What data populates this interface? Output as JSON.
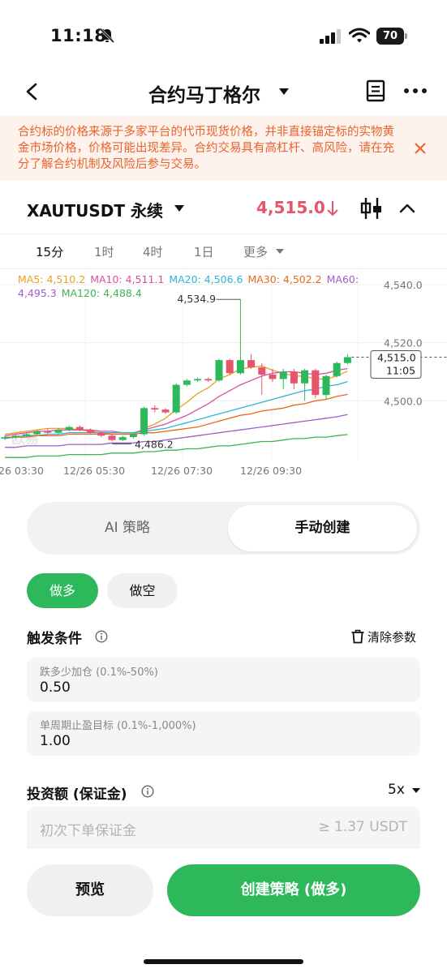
{
  "status_bar": {
    "time": "11:18",
    "battery": "70"
  },
  "header": {
    "title": "合约马丁格尔"
  },
  "notice": {
    "text": "合约标的价格来源于多家平台的代币现货价格，并非直接锚定标的实物黄金市场价格，价格可能出现差异。合约交易具有高杠杆、高风险，请在充分了解合约机制及风险后参与交易。"
  },
  "symbol": {
    "name": "XAUTUSDT 永续",
    "price": "4,515.0",
    "price_color": "#e5566d"
  },
  "timeframes": {
    "items": [
      "15分",
      "1时",
      "4时",
      "1日"
    ],
    "more": "更多",
    "active": "15分"
  },
  "chart": {
    "ma_legend": [
      {
        "label": "MA5: 4,510.2",
        "color": "#e8a21e"
      },
      {
        "label": "MA10: 4,511.1",
        "color": "#d94fa0"
      },
      {
        "label": "MA20: 4,506.6",
        "color": "#2bb5d6"
      },
      {
        "label": "MA30: 4,502.2",
        "color": "#e8691e"
      },
      {
        "label": "MA60:",
        "color": "#a05cc9"
      },
      {
        "label": "4,495.3",
        "color": "#a05cc9"
      },
      {
        "label": "MA120: 4,488.4",
        "color": "#3eb356"
      }
    ],
    "price_ticks": [
      "4,540.0",
      "4,520.0",
      "4,500.0"
    ],
    "current_price_tag": "4,515.0",
    "countdown": "11:05",
    "high_label": "4,534.9",
    "low_label": "4,486.2",
    "time_ticks": [
      "26 03:30",
      "12/26 05:30",
      "12/26 07:30",
      "12/26 09:30"
    ],
    "watermark": "欧易"
  },
  "chart_data": {
    "type": "candlestick",
    "up_color": "#2eb85c",
    "down_color": "#e5566d",
    "ylim": [
      4480,
      4545
    ],
    "yticks": [
      4540.0,
      4520.0,
      4500.0
    ],
    "candles": [
      {
        "o": 4487.0,
        "h": 4488.0,
        "l": 4486.5,
        "c": 4487.5
      },
      {
        "o": 4487.5,
        "h": 4488.5,
        "l": 4487.0,
        "c": 4488.0
      },
      {
        "o": 4488.0,
        "h": 4489.0,
        "l": 4487.5,
        "c": 4488.5
      },
      {
        "o": 4488.5,
        "h": 4490.0,
        "l": 4488.0,
        "c": 4489.5
      },
      {
        "o": 4489.5,
        "h": 4490.5,
        "l": 4488.5,
        "c": 4489.0
      },
      {
        "o": 4489.0,
        "h": 4490.5,
        "l": 4488.5,
        "c": 4490.0
      },
      {
        "o": 4490.0,
        "h": 4491.5,
        "l": 4489.5,
        "c": 4491.0
      },
      {
        "o": 4491.0,
        "h": 4491.5,
        "l": 4489.5,
        "c": 4490.0
      },
      {
        "o": 4490.0,
        "h": 4490.5,
        "l": 4488.5,
        "c": 4489.0
      },
      {
        "o": 4489.0,
        "h": 4489.5,
        "l": 4487.5,
        "c": 4488.0
      },
      {
        "o": 4488.0,
        "h": 4488.5,
        "l": 4486.0,
        "c": 4486.5
      },
      {
        "o": 4486.5,
        "h": 4488.0,
        "l": 4486.2,
        "c": 4487.5
      },
      {
        "o": 4487.5,
        "h": 4489.0,
        "l": 4487.0,
        "c": 4488.5
      },
      {
        "o": 4488.5,
        "h": 4498.0,
        "l": 4488.0,
        "c": 4497.5
      },
      {
        "o": 4497.5,
        "h": 4498.5,
        "l": 4496.0,
        "c": 4497.0
      },
      {
        "o": 4497.0,
        "h": 4497.5,
        "l": 4495.5,
        "c": 4496.0
      },
      {
        "o": 4496.0,
        "h": 4506.0,
        "l": 4495.5,
        "c": 4505.5
      },
      {
        "o": 4505.5,
        "h": 4507.5,
        "l": 4505.0,
        "c": 4507.0
      },
      {
        "o": 4507.0,
        "h": 4508.0,
        "l": 4506.5,
        "c": 4507.5
      },
      {
        "o": 4507.5,
        "h": 4508.0,
        "l": 4506.5,
        "c": 4507.0
      },
      {
        "o": 4507.0,
        "h": 4514.5,
        "l": 4506.5,
        "c": 4514.0
      },
      {
        "o": 4514.0,
        "h": 4514.5,
        "l": 4509.0,
        "c": 4509.5
      },
      {
        "o": 4509.5,
        "h": 4534.9,
        "l": 4509.0,
        "c": 4514.0
      },
      {
        "o": 4514.0,
        "h": 4516.0,
        "l": 4511.0,
        "c": 4511.5
      },
      {
        "o": 4511.5,
        "h": 4513.0,
        "l": 4502.0,
        "c": 4509.0
      },
      {
        "o": 4509.0,
        "h": 4511.0,
        "l": 4506.5,
        "c": 4507.5
      },
      {
        "o": 4507.5,
        "h": 4511.0,
        "l": 4504.0,
        "c": 4510.0
      },
      {
        "o": 4510.0,
        "h": 4511.0,
        "l": 4504.0,
        "c": 4506.0
      },
      {
        "o": 4506.0,
        "h": 4511.0,
        "l": 4500.0,
        "c": 4510.5
      },
      {
        "o": 4510.5,
        "h": 4511.0,
        "l": 4501.0,
        "c": 4502.0
      },
      {
        "o": 4502.0,
        "h": 4509.0,
        "l": 4500.5,
        "c": 4508.5
      },
      {
        "o": 4508.5,
        "h": 4513.5,
        "l": 4508.0,
        "c": 4513.0
      },
      {
        "o": 4513.0,
        "h": 4516.0,
        "l": 4512.5,
        "c": 4515.0
      }
    ],
    "ma_lines": [
      {
        "name": "MA5",
        "color": "#e8a21e",
        "values": [
          4488.5,
          4489.0,
          4489.5,
          4490.0,
          4490.5,
          4490.5,
          4490.5,
          4490.0,
          4489.5,
          4489.0,
          4488.5,
          4488.5,
          4488.5,
          4490.5,
          4492.0,
          4494.0,
          4497.0,
          4499.5,
          4502.5,
          4504.5,
          4507.5,
          4509.0,
          4511.0,
          4511.5,
          4512.0,
          4510.5,
          4509.5,
          4508.5,
          4508.5,
          4507.5,
          4507.5,
          4508.5,
          4510.2
        ]
      },
      {
        "name": "MA10",
        "color": "#d94fa0",
        "values": [
          4488.0,
          4488.5,
          4489.0,
          4489.5,
          4489.5,
          4490.0,
          4490.0,
          4490.0,
          4490.0,
          4489.5,
          4489.5,
          4489.0,
          4489.0,
          4490.0,
          4491.0,
          4492.0,
          4493.5,
          4495.0,
          4497.0,
          4499.0,
          4501.5,
          4503.5,
          4505.5,
          4507.0,
          4508.5,
          4509.5,
          4510.0,
          4510.0,
          4509.5,
          4509.0,
          4509.5,
          4510.5,
          4511.1
        ]
      },
      {
        "name": "MA20",
        "color": "#2bb5d6",
        "values": [
          4487.0,
          4487.5,
          4488.0,
          4488.0,
          4488.5,
          4488.5,
          4489.0,
          4489.0,
          4489.0,
          4489.0,
          4489.0,
          4489.0,
          4489.0,
          4489.5,
          4490.0,
          4490.5,
          4491.5,
          4492.5,
          4493.5,
          4494.5,
          4495.5,
          4496.5,
          4497.5,
          4498.5,
          4499.5,
          4500.5,
          4501.5,
          4502.5,
          4503.5,
          4504.0,
          4505.0,
          4505.5,
          4506.6
        ]
      },
      {
        "name": "MA30",
        "color": "#e8691e",
        "values": [
          4487.5,
          4487.5,
          4487.5,
          4488.0,
          4488.0,
          4488.0,
          4488.5,
          4488.5,
          4488.5,
          4488.5,
          4488.5,
          4488.5,
          4488.5,
          4489.0,
          4489.0,
          4489.5,
          4490.0,
          4490.5,
          4491.0,
          4492.0,
          4493.0,
          4494.0,
          4495.0,
          4495.5,
          4496.5,
          4497.0,
          4497.5,
          4498.5,
          4499.0,
          4500.0,
          4500.5,
          4501.5,
          4502.2
        ]
      },
      {
        "name": "MA60",
        "color": "#a05cc9",
        "values": [
          4484.0,
          4484.0,
          4484.5,
          4484.5,
          4484.5,
          4484.5,
          4485.0,
          4485.0,
          4485.0,
          4485.0,
          4485.5,
          4485.5,
          4485.5,
          4486.0,
          4486.0,
          4486.5,
          4487.0,
          4487.5,
          4488.0,
          4488.5,
          4489.0,
          4489.5,
          4490.0,
          4490.5,
          4491.0,
          4491.5,
          4492.0,
          4492.5,
          4493.0,
          4493.5,
          4494.0,
          4494.5,
          4495.3
        ]
      },
      {
        "name": "MA120",
        "color": "#3eb356",
        "values": [
          4480.5,
          4480.5,
          4480.5,
          4481.0,
          4481.0,
          4481.0,
          4481.5,
          4481.5,
          4481.5,
          4481.5,
          4482.0,
          4482.0,
          4482.0,
          4482.5,
          4482.5,
          4483.0,
          4483.0,
          4483.5,
          4483.5,
          4484.0,
          4484.5,
          4484.5,
          4485.0,
          4485.5,
          4486.0,
          4486.0,
          4486.5,
          4487.0,
          4487.0,
          4487.5,
          4487.5,
          4488.0,
          4488.4
        ]
      }
    ]
  },
  "mode_toggle": {
    "ai": "AI 策略",
    "manual": "手动创建"
  },
  "side": {
    "long": "做多",
    "short": "做空"
  },
  "trigger": {
    "title": "触发条件",
    "clear": "清除参数",
    "fields": [
      {
        "label": "跌多少加仓 (0.1%-50%)",
        "value": "0.50"
      },
      {
        "label": "单周期止盈目标 (0.1%-1,000%)",
        "value": "1.00"
      }
    ]
  },
  "investment": {
    "title": "投资额 (保证金)",
    "leverage": "5x",
    "placeholder": "初次下单保证金",
    "min": "≥ 1.37 USDT"
  },
  "actions": {
    "preview": "预览",
    "create": "创建策略 (做多)"
  }
}
